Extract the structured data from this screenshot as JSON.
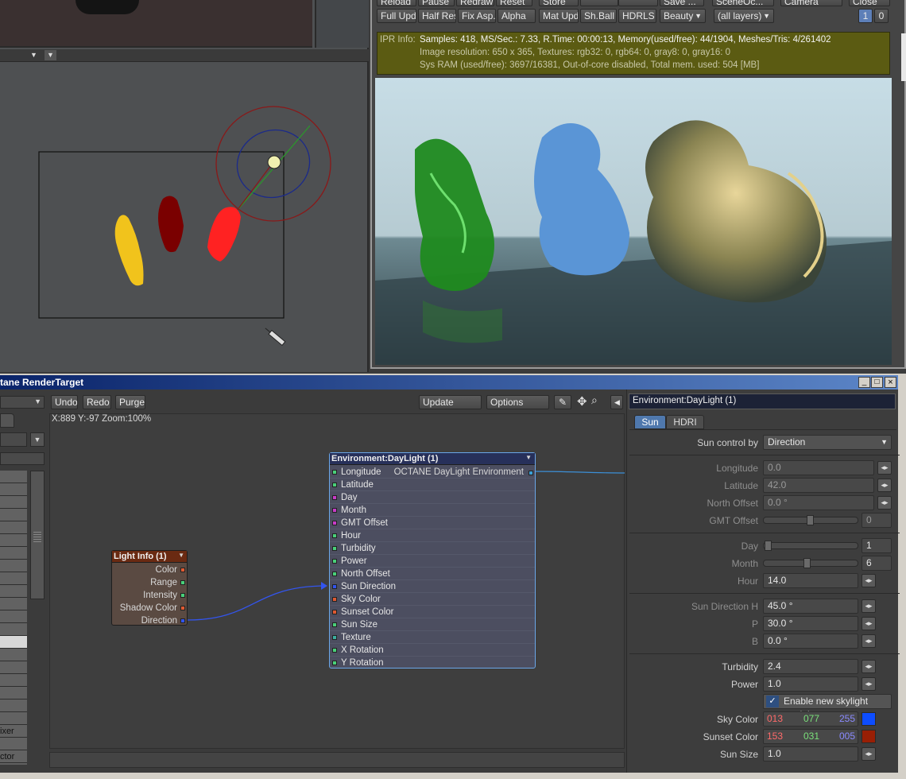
{
  "render_toolbar": {
    "row1": [
      "Reload",
      "Pause",
      "Redraw",
      "Reset",
      "Store",
      "",
      "Save ...",
      "SceneOc...",
      "Camera",
      "Close"
    ],
    "row2": [
      "Full Upd.",
      "Half Res",
      "Fix Asp.",
      "Alpha",
      "Mat Upd",
      "Sh.Ball",
      "HDRLS"
    ],
    "beauty_select": "Beauty",
    "layers_select": "(all layers)",
    "page_buttons": [
      "1",
      "0"
    ]
  },
  "ipr": {
    "label": "IPR Info:",
    "line1": "Samples: 418, MS/Sec.: 7.33, R.Time: 00:00:13, Memory(used/free): 44/1904, Meshes/Tris: 4/261402",
    "line2": "Image resolution: 650 x 365, Textures:  rgb32: 0, rgb64: 0, gray8: 0, gray16: 0",
    "line3": "Sys RAM (used/free): 3697/16381, Out-of-core disabled, Total mem. used: 504  [MB]"
  },
  "node_editor": {
    "title": "tane RenderTarget",
    "buttons": {
      "undo": "Undo",
      "redo": "Redo",
      "purge": "Purge",
      "update": "Update",
      "options": "Options"
    },
    "coords": "X:889 Y:-97 Zoom:100%",
    "left_partial": [
      "ixer",
      "ctor"
    ],
    "light_node": {
      "title": "Light Info (1)",
      "outputs": [
        "Color",
        "Range",
        "Intensity",
        "Shadow Color",
        "Direction"
      ]
    },
    "daylight_node": {
      "title": "Environment:DayLight (1)",
      "output": "OCTANE DayLight Environment",
      "inputs": [
        "Longitude",
        "Latitude",
        "Day",
        "Month",
        "GMT Offset",
        "Hour",
        "Turbidity",
        "Power",
        "North Offset",
        "Sun Direction",
        "Sky Color",
        "Sunset Color",
        "Sun Size",
        "Texture",
        "X Rotation",
        "Y Rotation"
      ]
    }
  },
  "panel": {
    "title": "Environment:DayLight (1)",
    "tabs": [
      "Sun",
      "HDRI"
    ],
    "sun_control_label": "Sun control by",
    "sun_control_value": "Direction",
    "longitude_label": "Longitude",
    "longitude": "0.0",
    "latitude_label": "Latitude",
    "latitude": "42.0",
    "north_offset_label": "North Offset",
    "north_offset": "0.0 °",
    "gmt_offset_label": "GMT Offset",
    "gmt_offset": "0",
    "day_label": "Day",
    "day": "1",
    "month_label": "Month",
    "month": "6",
    "hour_label": "Hour",
    "hour": "14.0",
    "sun_dir_h_label": "Sun Direction H",
    "sun_dir_h": "45.0 °",
    "p_label": "P",
    "p": "30.0 °",
    "b_label": "B",
    "b": "0.0 °",
    "turbidity_label": "Turbidity",
    "turbidity": "2.4",
    "power_label": "Power",
    "power": "1.0",
    "skylight_checkbox": "Enable new skylight model",
    "sky_color_label": "Sky Color",
    "sky_r": "013",
    "sky_g": "077",
    "sky_b": "255",
    "sky_swatch": "#0d4dff",
    "sunset_color_label": "Sunset Color",
    "sunset_r": "153",
    "sunset_g": "031",
    "sunset_b": "005",
    "sunset_swatch": "#991f05",
    "sun_size_label": "Sun Size",
    "sun_size": "1.0"
  }
}
